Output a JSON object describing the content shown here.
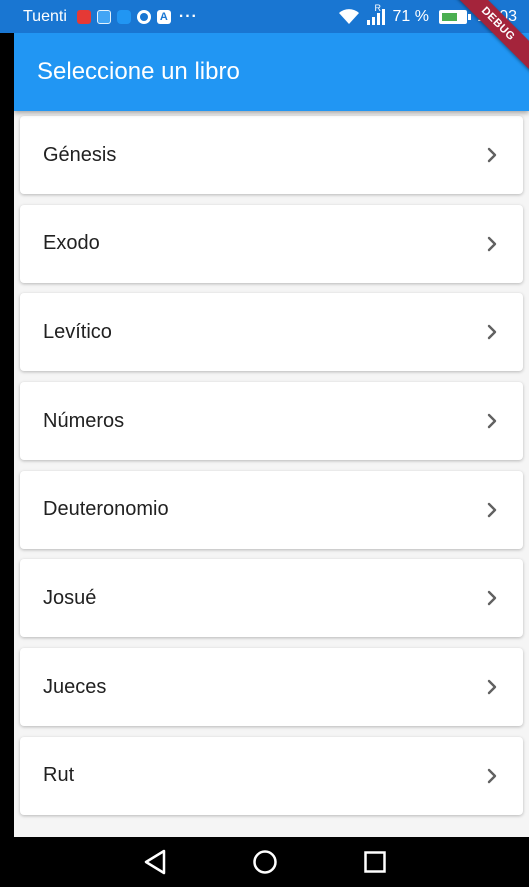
{
  "status_bar": {
    "carrier": "Tuenti",
    "ellipsis": "···",
    "signal_label": "R",
    "battery_percent_text": "71 %",
    "battery_level": 0.71,
    "time": "12:03",
    "notification_icons": [
      "video-icon",
      "usb-icon",
      "chat-icon",
      "whatsapp-icon",
      "a-icon"
    ]
  },
  "app_bar": {
    "title": "Seleccione un libro"
  },
  "debug_banner": "DEBUG",
  "books": [
    {
      "name": "Génesis"
    },
    {
      "name": "Exodo"
    },
    {
      "name": "Levítico"
    },
    {
      "name": "Números"
    },
    {
      "name": "Deuteronomio"
    },
    {
      "name": "Josué"
    },
    {
      "name": "Jueces"
    },
    {
      "name": "Rut"
    }
  ],
  "colors": {
    "app_bar": "#2196f3",
    "status_bar": "#1976d2",
    "debug_banner": "#a4243b",
    "background": "#f5f5f5"
  },
  "nav_bar": {
    "icons": [
      "back-icon",
      "home-icon",
      "recents-icon"
    ]
  }
}
